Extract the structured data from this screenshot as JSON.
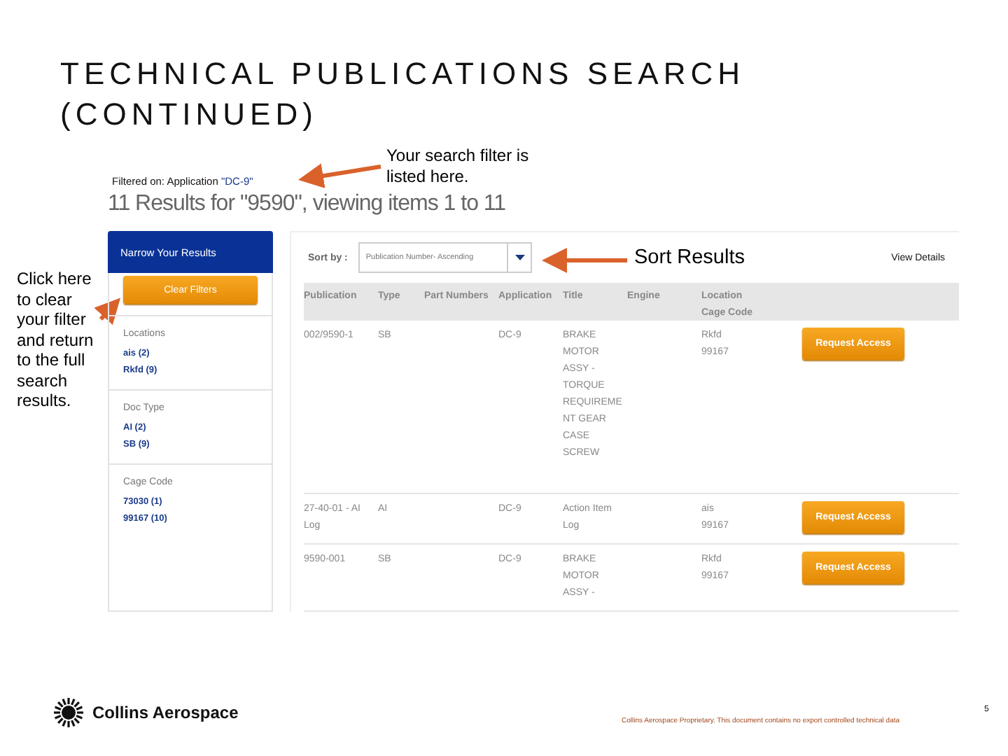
{
  "slide": {
    "title": "TECHNICAL PUBLICATIONS SEARCH (CONTINUED)",
    "callouts": [
      {
        "text": "Your search filter is listed here."
      },
      {
        "text": "Sort Results"
      },
      {
        "text": "Click here to clear your filter and return to the full search results."
      }
    ],
    "logo_text": "Collins Aerospace",
    "footer_note": "Collins Aerospace Proprietary. This document contains no export controlled technical data",
    "page_number": "5"
  },
  "screen": {
    "filter_label": "Filtered on: Application",
    "filter_value": "\"DC-9\"",
    "heading": "11 Results for \"9590\", viewing items 1 to 11",
    "sidebar": {
      "title": "Narrow Your Results",
      "clear_button": "Clear Filters",
      "groups": [
        {
          "title": "Locations",
          "items": [
            "ais (2)",
            "Rkfd (9)"
          ]
        },
        {
          "title": "Doc Type",
          "items": [
            "AI (2)",
            "SB (9)"
          ]
        },
        {
          "title": "Cage Code",
          "items": [
            "73030 (1)",
            "99167 (10)"
          ]
        }
      ]
    },
    "sort": {
      "label": "Sort by :",
      "value": "Publication Number- Ascending"
    },
    "view_details": "View Details",
    "columns": [
      [
        "Publication"
      ],
      [
        "Type"
      ],
      [
        "Part Numbers"
      ],
      [
        "Application"
      ],
      [
        "Title"
      ],
      [
        "Engine"
      ],
      [
        "Location",
        "Cage Code"
      ]
    ],
    "rows": [
      {
        "publication": [
          "002/9590-1"
        ],
        "type": "SB",
        "application": "DC-9",
        "title": [
          "BRAKE",
          "MOTOR",
          "ASSY -",
          "TORQUE",
          "REQUIREME",
          "NT GEAR",
          "CASE",
          "SCREW"
        ],
        "location": [
          "Rkfd",
          "99167"
        ],
        "action": "Request Access"
      },
      {
        "publication": [
          "27-40-01 - AI",
          "Log"
        ],
        "type": "AI",
        "application": "DC-9",
        "title": [
          "Action Item",
          "Log"
        ],
        "location": [
          "ais",
          "99167"
        ],
        "action": "Request Access"
      },
      {
        "publication": [
          "9590-001"
        ],
        "type": "SB",
        "application": "DC-9",
        "title": [
          "BRAKE",
          "MOTOR",
          "ASSY -"
        ],
        "location": [
          "Rkfd",
          "99167"
        ],
        "action": "Request Access"
      }
    ]
  }
}
